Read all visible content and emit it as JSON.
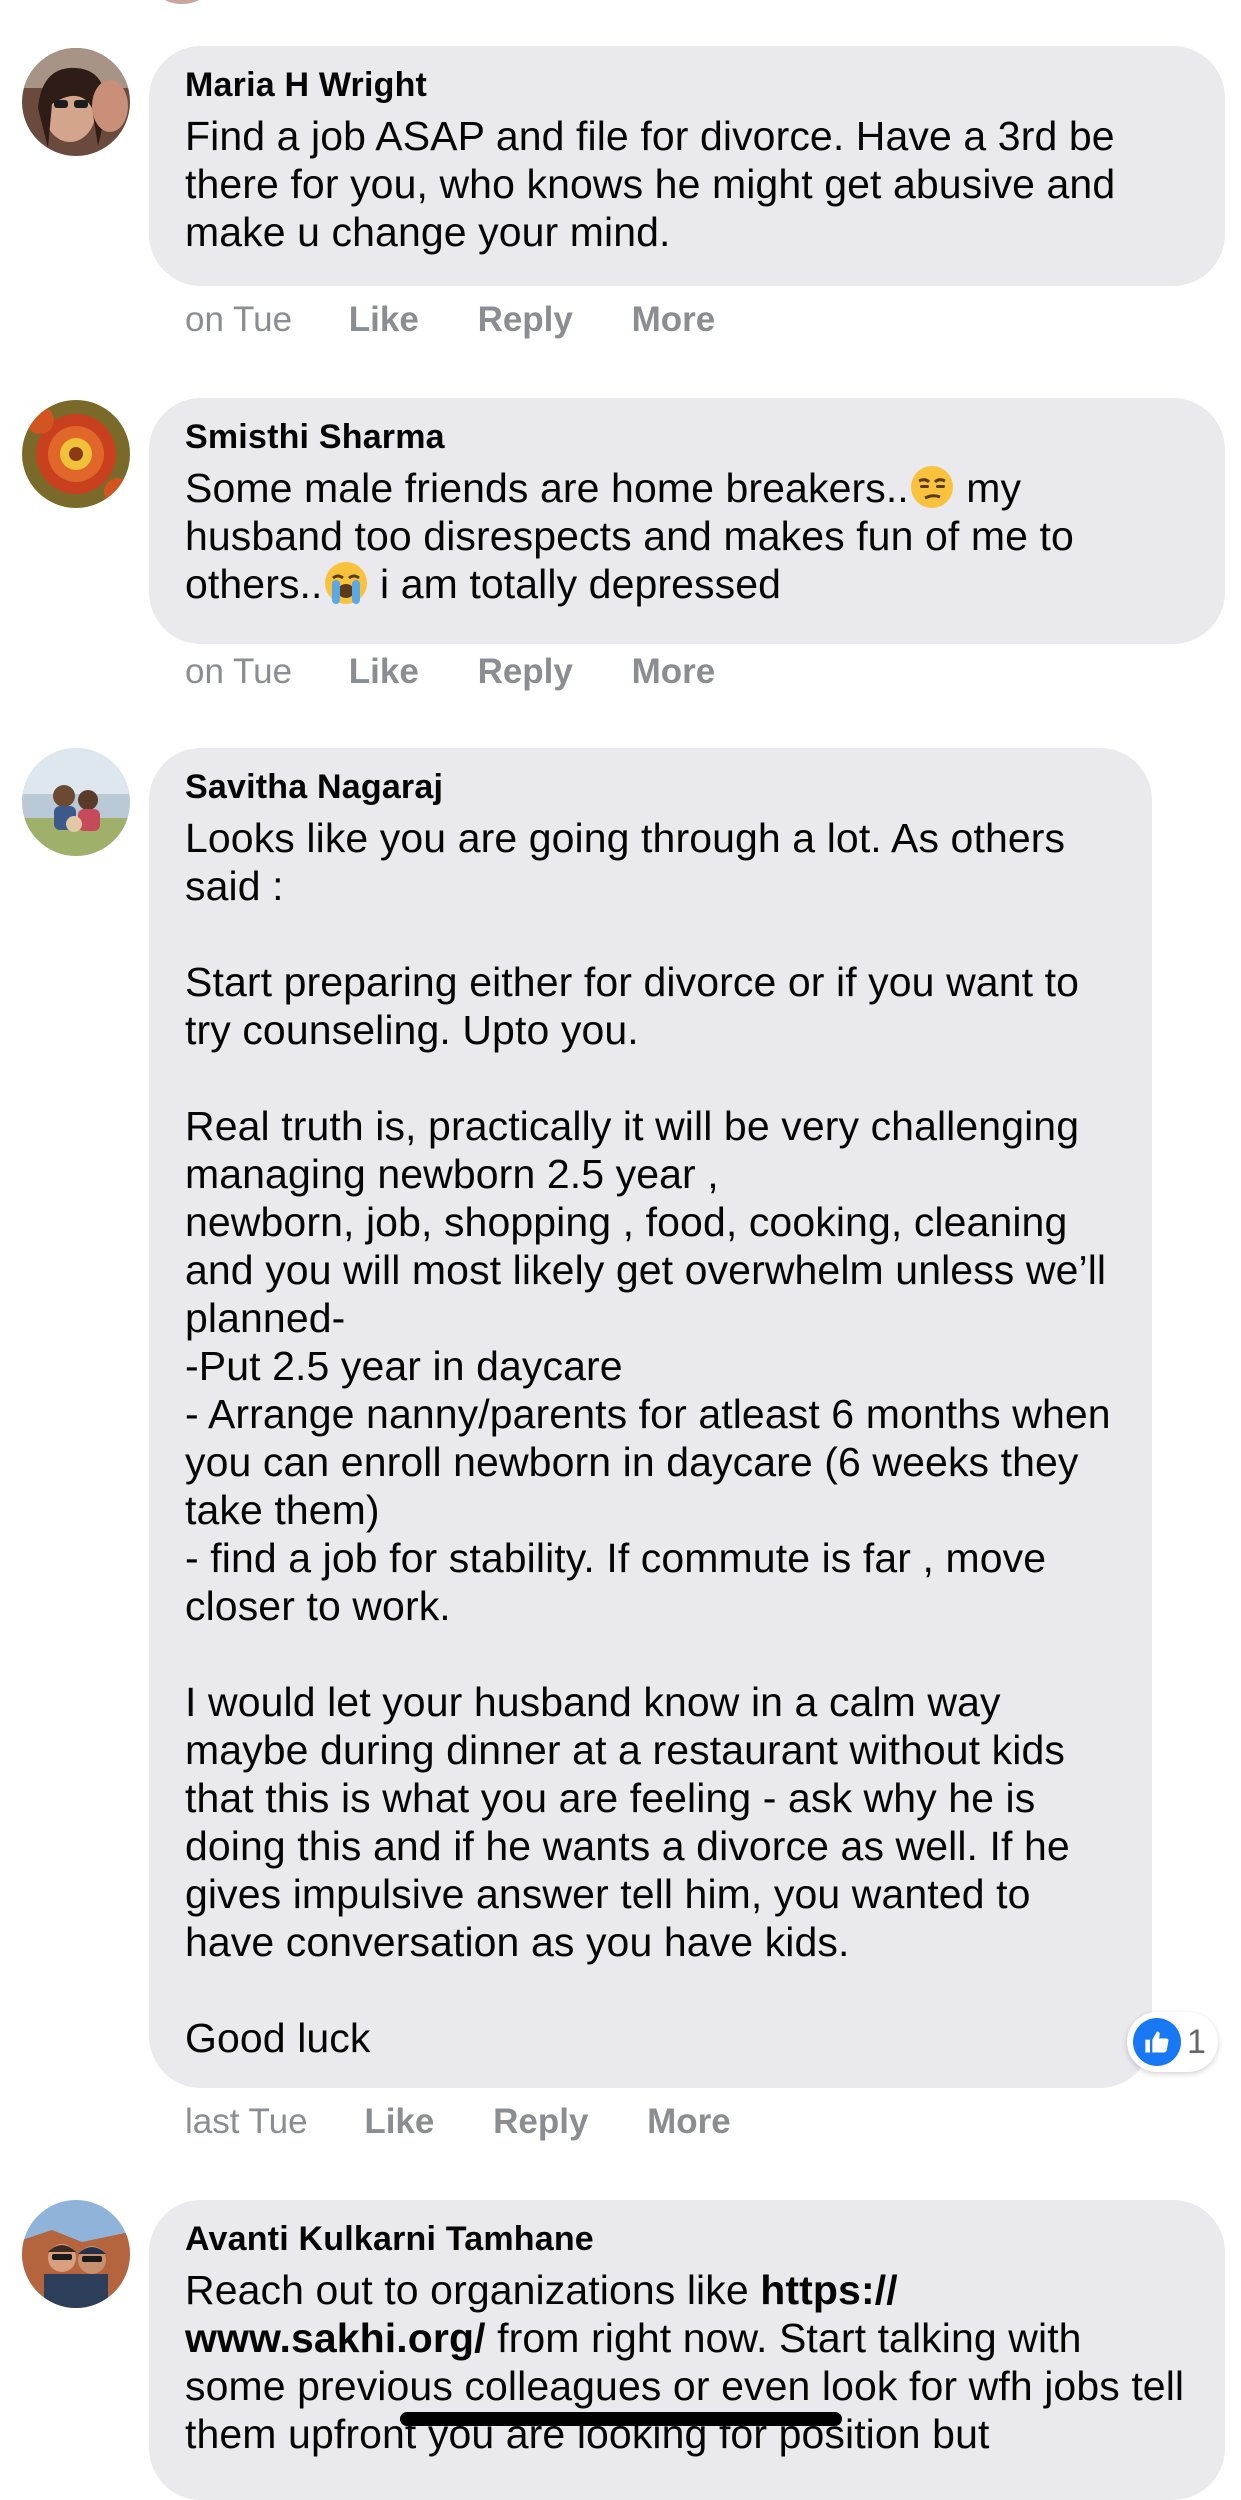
{
  "comments": [
    {
      "author": "Maria H Wright",
      "text": "Find a job ASAP and file for divorce. Have a 3rd be there for you, who knows he might get abusive and make u change your mind.",
      "time": "on Tue",
      "actions": [
        "Like",
        "Reply",
        "More"
      ]
    },
    {
      "author": "Smisthi Sharma",
      "text_part1": "Some male friends are home breakers..",
      "emoji1": "😒",
      "text_part2": " my husband too disrespects and makes fun of me to others..",
      "emoji2": "😭",
      "text_part3": " i am totally depressed",
      "time": "on Tue",
      "actions": [
        "Like",
        "Reply",
        "More"
      ]
    },
    {
      "author": "Savitha Nagaraj",
      "text": "Looks like you are going through a lot. As others said :\n\nStart preparing either for divorce or if you want to try counseling. Upto you.\n\nReal truth is, practically it will be very challenging managing newborn 2.5 year ,\nnewborn, job, shopping , food, cooking, cleaning and you will most likely get overwhelm unless we’ll planned-\n-Put 2.5 year in daycare\n- Arrange nanny/parents for atleast 6 months when you can enroll newborn in daycare (6 weeks they take them)\n- find a job for stability. If commute is far , move closer to work.\n\nI would let your husband know in a calm way maybe during dinner at a restaurant without kids that this is what you are feeling - ask why he is doing this and if he wants a divorce as well. If he gives impulsive answer tell him, you wanted to have conversation as you have kids.\n\nGood luck",
      "time": "last Tue",
      "actions": [
        "Like",
        "Reply",
        "More"
      ],
      "reaction_count": "1"
    },
    {
      "author": "Avanti Kulkarni Tamhane",
      "text_part1": "Reach out to organizations like ",
      "link": "https://\nwww.sakhi.org/",
      "text_part2": " from right now. Start talking with some previous colleagues or even look for wfh jobs tell them upfront you are looking for position but"
    }
  ],
  "colors": {
    "bubble": "#e9e9ee",
    "meta": "#8a8d91",
    "like_blue": "#1877f2"
  },
  "icons": [
    "thumbs-up-icon",
    "unamused-face-emoji",
    "loudly-crying-face-emoji"
  ]
}
